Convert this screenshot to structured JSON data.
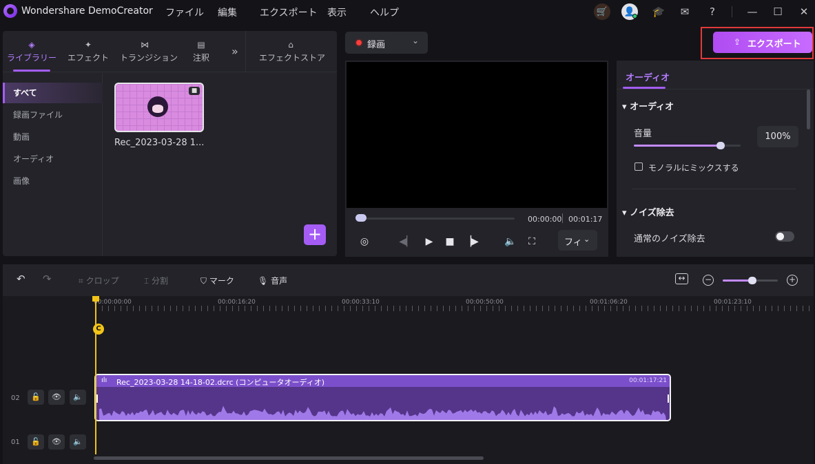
{
  "app": {
    "title": "Wondershare DemoCreator"
  },
  "menu": [
    "ファイル",
    "編集",
    "エクスポート",
    "表示",
    "ヘルプ"
  ],
  "library": {
    "tabs": [
      {
        "label": "ライブラリー",
        "icon": "layers-icon"
      },
      {
        "label": "エフェクト",
        "icon": "sparkle-icon"
      },
      {
        "label": "トランジション",
        "icon": "bowtie-icon"
      },
      {
        "label": "注釈",
        "icon": "comment-icon"
      }
    ],
    "more": "»",
    "store": {
      "label": "エフェクトストア",
      "icon": "store-icon"
    },
    "sidebar": [
      "すべて",
      "録画ファイル",
      "動画",
      "オーディオ",
      "画像"
    ],
    "media": [
      {
        "name": "Rec_2023-03-28 1..."
      }
    ],
    "add": "+"
  },
  "preview": {
    "record_label": "録画",
    "time_current": "00:00:00",
    "time_total": "00:01:17",
    "fit_label": "フィ"
  },
  "export": {
    "label": "エクスポート"
  },
  "properties": {
    "tab": "オーディオ",
    "section_audio": "オーディオ",
    "volume_label": "音量",
    "volume_value": "100%",
    "volume_level": 0.8,
    "mono_label": "モノラルにミックスする",
    "section_denoise": "ノイズ除去",
    "denoise_label": "通常のノイズ除去",
    "denoise_on": false
  },
  "timeline": {
    "toolbar": {
      "crop": "クロップ",
      "split": "分割",
      "mark": "マーク",
      "voice": "音声"
    },
    "ruler": [
      "00:00:00:00",
      "00:00:16:20",
      "00:00:33:10",
      "00:00:50:00",
      "00:01:06:20",
      "00:01:23:10"
    ],
    "tracks": [
      "02",
      "01"
    ],
    "clip": {
      "name": "Rec_2023-03-28 14-18-02.dcrc (コンピュータオーディオ)",
      "duration": "00:01:17:21"
    },
    "marker": "C"
  }
}
